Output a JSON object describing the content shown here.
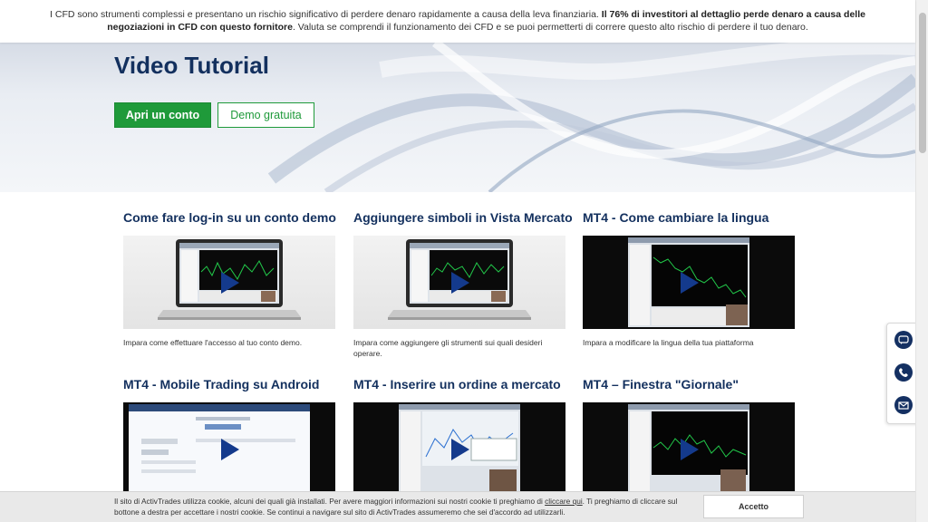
{
  "risk_warning": {
    "text_part1": "I CFD sono strumenti complessi e presentano un rischio significativo di perdere denaro rapidamente a causa della leva finanziaria. ",
    "text_bold": "Il 76% di investitori al dettaglio perde denaro a causa delle negoziazioni in CFD con questo fornitore",
    "text_part2": ". Valuta se comprendi il funzionamento dei CFD e se puoi permetterti di correre questo alto rischio di perdere il tuo denaro."
  },
  "hero": {
    "title": "Video Tutorial",
    "primary_button": "Apri un conto",
    "secondary_button": "Demo gratuita"
  },
  "videos": [
    {
      "title": "Come fare log-in su un conto demo",
      "description": "Impara come effettuare l'accesso al tuo conto demo."
    },
    {
      "title": "Aggiungere simboli in Vista Mercato",
      "description": "Impara come aggiungere gli strumenti sui quali desideri operare."
    },
    {
      "title": "MT4 - Come cambiare la lingua",
      "description": "Impara a modificare la lingua della tua piattaforma"
    },
    {
      "title": "MT4 - Mobile Trading su Android",
      "description": ""
    },
    {
      "title": "MT4 - Inserire un ordine a mercato",
      "description": ""
    },
    {
      "title": "MT4 – Finestra \"Giornale\"",
      "description": ""
    }
  ],
  "cookie": {
    "text_part1": "Il sito di ActivTrades utilizza cookie, alcuni dei quali già installati. Per avere maggiori informazioni sui nostri cookie ti preghiamo di ",
    "link": "cliccare qui",
    "text_part2": ". Ti preghiamo di cliccare sul bottone a destra per accettare i nostri cookie. Se continui a navigare sul sito di ActivTrades assumeremo che sei d'accordo ad utilizzarli.",
    "accept_button": "Accetto"
  },
  "side_widget": {
    "icons": [
      "chat-icon",
      "phone-icon",
      "email-icon"
    ]
  },
  "colors": {
    "brand_navy": "#13305e",
    "accent_green": "#1f9a3a",
    "play_blue": "#143a8c"
  }
}
